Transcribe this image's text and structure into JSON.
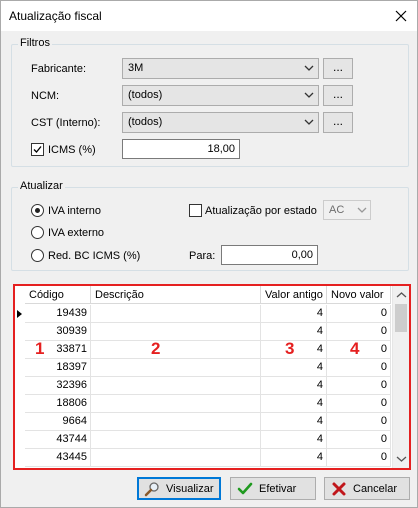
{
  "window": {
    "title": "Atualização fiscal",
    "close_icon": "close-icon"
  },
  "filtros": {
    "title": "Filtros",
    "fabricante": {
      "label": "Fabricante:",
      "value": "3M",
      "dots": "..."
    },
    "ncm": {
      "label": "NCM:",
      "value": "(todos)",
      "dots": "..."
    },
    "cst": {
      "label": "CST (Interno):",
      "value": "(todos)",
      "dots": "..."
    },
    "icms": {
      "label": "ICMS (%)",
      "checked": true,
      "value": "18,00"
    }
  },
  "atualizar": {
    "title": "Atualizar",
    "iva_interno": "IVA interno",
    "iva_externo": "IVA externo",
    "red_bc": "Red. BC ICMS (%)",
    "por_estado": "Atualização por estado",
    "estado_value": "AC",
    "para_label": "Para:",
    "para_value": "0,00"
  },
  "grid": {
    "columns": [
      "Código",
      "Descrição",
      "Valor antigo",
      "Novo valor"
    ],
    "rows": [
      {
        "codigo": "19439",
        "descricao": "",
        "valor_antigo": "4",
        "novo_valor": "0"
      },
      {
        "codigo": "30939",
        "descricao": "",
        "valor_antigo": "4",
        "novo_valor": "0"
      },
      {
        "codigo": "33871",
        "descricao": "",
        "valor_antigo": "4",
        "novo_valor": "0"
      },
      {
        "codigo": "18397",
        "descricao": "",
        "valor_antigo": "4",
        "novo_valor": "0"
      },
      {
        "codigo": "32396",
        "descricao": "",
        "valor_antigo": "4",
        "novo_valor": "0"
      },
      {
        "codigo": "18806",
        "descricao": "",
        "valor_antigo": "4",
        "novo_valor": "0"
      },
      {
        "codigo": "9664",
        "descricao": "",
        "valor_antigo": "4",
        "novo_valor": "0"
      },
      {
        "codigo": "43744",
        "descricao": "",
        "valor_antigo": "4",
        "novo_valor": "0"
      },
      {
        "codigo": "43445",
        "descricao": "",
        "valor_antigo": "4",
        "novo_valor": "0"
      }
    ],
    "markers": [
      "1",
      "2",
      "3",
      "4"
    ],
    "marker_color": "#e52020"
  },
  "buttons": {
    "visualizar": "Visualizar",
    "efetivar": "Efetivar",
    "cancelar": "Cancelar"
  },
  "colors": {
    "accent": "#0078d7",
    "marker": "#e52020",
    "check": "#1f9a1f",
    "cancel": "#c0161b"
  }
}
